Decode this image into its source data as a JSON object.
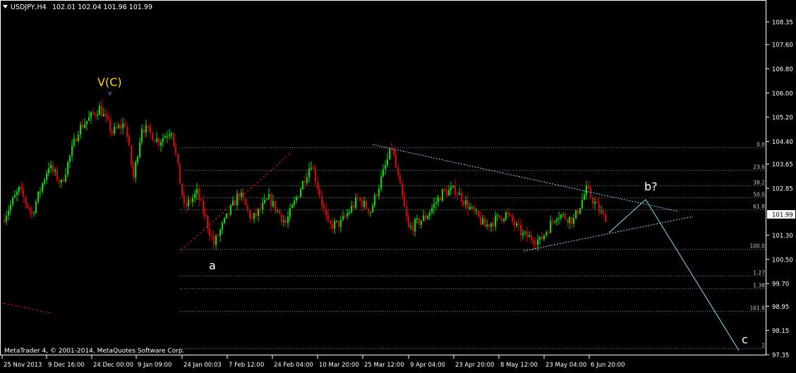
{
  "header": {
    "symbol_label": "USDJPY,H4",
    "ohlc_label": "102.01 102.04 101.96 101.99"
  },
  "footer": {
    "copyright": "MetaTrader 4, © 2001-2014, MetaQuotes Software Corp."
  },
  "colors": {
    "background": "#000000",
    "bull_candle": "#00e000",
    "bear_candle": "#e00000",
    "frame": "#ffffff",
    "grid_level": "#808080",
    "trendline_cyan": "#7fdfff",
    "wave_label_yellow": "#ffd700",
    "price_marker_bg": "#ffffff",
    "dashed_red": "#d01818"
  },
  "annotations": {
    "wave_top": "V(C)",
    "wave_top_marker": "v",
    "wave_a": "a",
    "wave_b": "b?",
    "wave_c": "c"
  },
  "chart_data": {
    "type": "candlestick",
    "ylim": [
      97.35,
      108.9
    ],
    "y_ticks": [
      "108.35",
      "107.60",
      "106.80",
      "106.00",
      "105.20",
      "104.40",
      "103.65",
      "102.85",
      "101.99",
      "101.30",
      "100.50",
      "99.70",
      "98.95",
      "98.15",
      "97.35"
    ],
    "current_price": "101.99",
    "x_ticks": [
      "25 Nov 2013",
      "9 Dec 16:00",
      "24 Dec 00:00",
      "9 Jan 09:00",
      "24 Jan 00:03",
      "7 Feb 12:00",
      "24 Feb 04:00",
      "10 Mar 20:00",
      "25 Mar 12:00",
      "9 Apr 04:00",
      "23 Apr 20:00",
      "8 May 12:00",
      "23 May 04:00",
      "6 Jun 20:00"
    ],
    "fibo_levels": [
      {
        "label": "0.0",
        "value": 104.2
      },
      {
        "label": "23.6",
        "value": 103.45
      },
      {
        "label": "38.2",
        "value": 102.95
      },
      {
        "label": "50.0",
        "value": 102.55
      },
      {
        "label": "61.8",
        "value": 102.15
      },
      {
        "label": "100.0",
        "value": 100.85
      },
      {
        "label": "1.27",
        "value": 99.95
      },
      {
        "label": "1.38",
        "value": 99.55
      },
      {
        "label": "161.8",
        "value": 98.8
      },
      {
        "label": "2",
        "value": 97.55
      }
    ],
    "price_path": [
      {
        "bar": 0,
        "price": 101.8
      },
      {
        "bar": 8,
        "price": 102.8
      },
      {
        "bar": 14,
        "price": 102.0
      },
      {
        "bar": 22,
        "price": 103.6
      },
      {
        "bar": 28,
        "price": 103.0
      },
      {
        "bar": 36,
        "price": 104.8
      },
      {
        "bar": 46,
        "price": 105.5
      },
      {
        "bar": 52,
        "price": 104.7
      },
      {
        "bar": 58,
        "price": 105.0
      },
      {
        "bar": 62,
        "price": 103.2
      },
      {
        "bar": 66,
        "price": 104.9
      },
      {
        "bar": 74,
        "price": 104.4
      },
      {
        "bar": 80,
        "price": 104.8
      },
      {
        "bar": 86,
        "price": 102.2
      },
      {
        "bar": 92,
        "price": 102.7
      },
      {
        "bar": 100,
        "price": 101.0
      },
      {
        "bar": 104,
        "price": 101.6
      },
      {
        "bar": 112,
        "price": 102.7
      },
      {
        "bar": 118,
        "price": 101.8
      },
      {
        "bar": 126,
        "price": 102.5
      },
      {
        "bar": 134,
        "price": 101.7
      },
      {
        "bar": 146,
        "price": 103.7
      },
      {
        "bar": 154,
        "price": 101.6
      },
      {
        "bar": 160,
        "price": 101.7
      },
      {
        "bar": 168,
        "price": 102.5
      },
      {
        "bar": 174,
        "price": 102.1
      },
      {
        "bar": 184,
        "price": 104.2
      },
      {
        "bar": 192,
        "price": 101.5
      },
      {
        "bar": 200,
        "price": 101.9
      },
      {
        "bar": 208,
        "price": 102.7
      },
      {
        "bar": 214,
        "price": 102.8
      },
      {
        "bar": 222,
        "price": 102.1
      },
      {
        "bar": 228,
        "price": 101.6
      },
      {
        "bar": 238,
        "price": 102.0
      },
      {
        "bar": 246,
        "price": 101.3
      },
      {
        "bar": 254,
        "price": 101.1
      },
      {
        "bar": 262,
        "price": 102.0
      },
      {
        "bar": 270,
        "price": 101.8
      },
      {
        "bar": 276,
        "price": 102.8
      },
      {
        "bar": 284,
        "price": 101.9
      }
    ],
    "candle_count": 285,
    "wave_points": {
      "v_c_top": {
        "bar": 48,
        "price": 105.6
      },
      "a_low": {
        "bar": 100,
        "price": 100.85
      },
      "b_high": {
        "bar": 301,
        "price": 102.6
      },
      "c_target": {
        "bar": 345,
        "price": 97.55
      }
    }
  }
}
